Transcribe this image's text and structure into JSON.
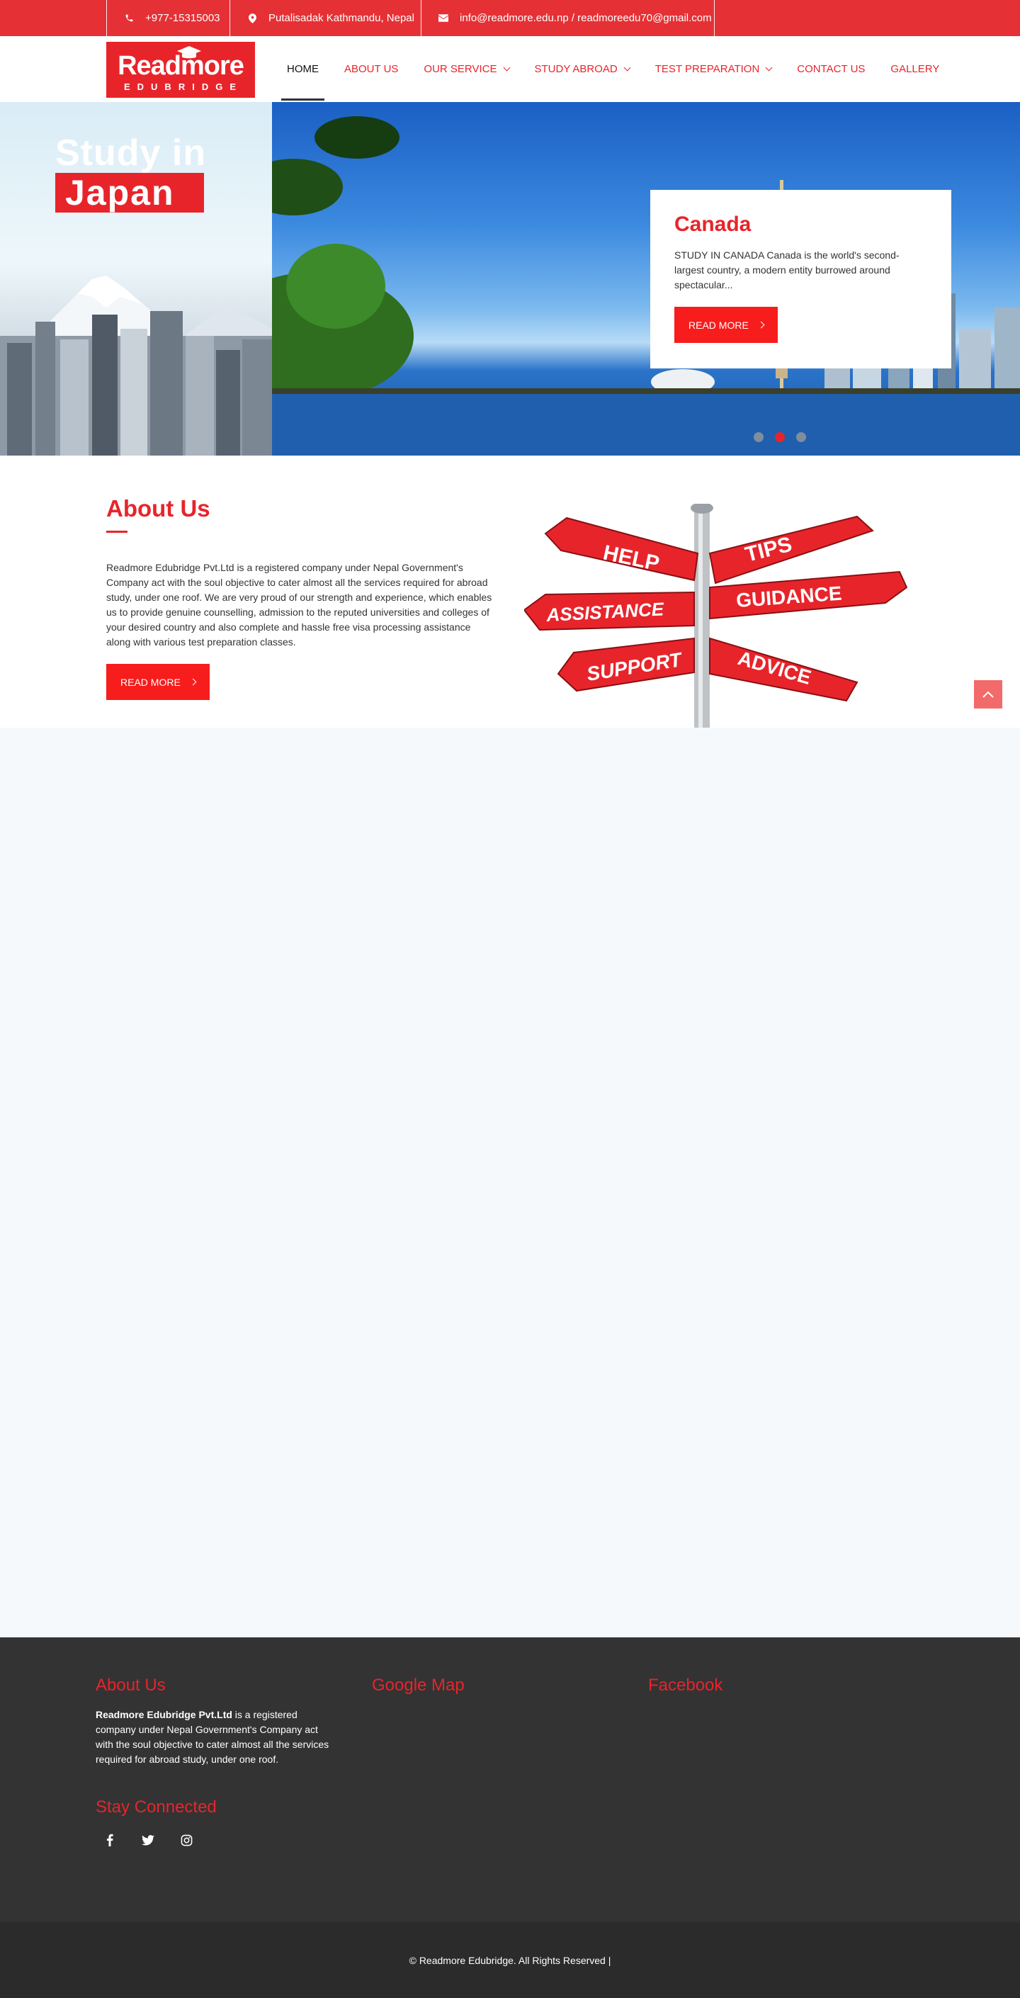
{
  "topbar": {
    "phone": "+977-15315003",
    "address": "Putalisadak Kathmandu, Nepal",
    "email": "info@readmore.edu.np / readmoreedu70@gmail.com"
  },
  "logo": {
    "line1": "Readmore",
    "line2": "EDUBRIDGE"
  },
  "nav": [
    {
      "label": "HOME",
      "active": true
    },
    {
      "label": "ABOUT US"
    },
    {
      "label": "OUR SERVICE",
      "dropdown": true
    },
    {
      "label": "STUDY ABROAD",
      "dropdown": true
    },
    {
      "label": "TEST PREPARATION",
      "dropdown": true
    },
    {
      "label": "CONTACT US"
    },
    {
      "label": "GALLERY"
    }
  ],
  "hero": {
    "side_title_1": "Study in",
    "side_title_2": "Japan",
    "card_title": "Canada",
    "card_text": "STUDY IN CANADA Canada is the world's second-largest country, a modern entity burrowed around spectacular...",
    "card_button": "READ MORE",
    "active_slide": 2,
    "slide_count": 3
  },
  "about": {
    "title": "About Us",
    "text": "Readmore Edubridge Pvt.Ltd  is a registered company under Nepal Government's Company act with the soul objective to cater almost all the services required for abroad study, under one roof. We are very proud of our strength and experience, which enables us to provide genuine counselling, admission to the reputed universities and colleges of your desired country and also complete and hassle free visa processing assistance along with various test preparation classes.",
    "button": "READ MORE",
    "sign_words": [
      "HELP",
      "TIPS",
      "ASSISTANCE",
      "GUIDANCE",
      "SUPPORT",
      "ADVICE"
    ]
  },
  "footer": {
    "about_title": "About Us",
    "about_company": "Readmore Edubridge Pvt.Ltd",
    "about_text": " is a registered company under Nepal Government's Company act with the soul objective to cater almost all the services required for abroad study, under one roof.",
    "map_title": "Google Map",
    "facebook_title": "Facebook",
    "stay_title": "Stay Connected",
    "social_icons": [
      "facebook-icon",
      "twitter-icon",
      "instagram-icon"
    ]
  },
  "copyright": "© Readmore Edubridge. All Rights Reserved  |",
  "colors": {
    "brand": "#e8242b",
    "topbar": "#e53135",
    "footer": "#333333",
    "bottom": "#2b2b2b"
  }
}
